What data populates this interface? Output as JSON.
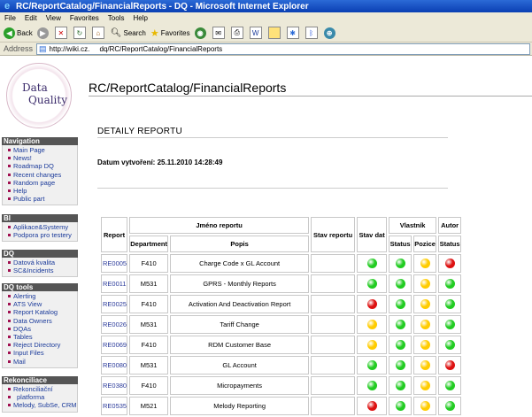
{
  "window": {
    "title": "RC/ReportCatalog/FinancialReports - DQ - Microsoft Internet Explorer"
  },
  "menu": [
    "File",
    "Edit",
    "View",
    "Favorites",
    "Tools",
    "Help"
  ],
  "toolbar": {
    "back": "Back",
    "search": "Search",
    "favorites": "Favorites"
  },
  "address": {
    "label": "Address",
    "url": "http://wiki.cz.     dq/RC/ReportCatalog/FinancialReports"
  },
  "logo": {
    "line1": "Data",
    "line2": "Quality"
  },
  "sidebar": [
    {
      "title": "Navigation",
      "items": [
        "Main Page",
        "News!",
        "Roadmap DQ",
        "Recent changes",
        "Random page",
        "Help",
        "Public part"
      ]
    },
    {
      "title": "BI",
      "items": [
        "Aplikace&Systemy",
        "Podpora pro testery"
      ]
    },
    {
      "title": "DQ",
      "items": [
        "Datová kvalita",
        "SC&Incidents"
      ]
    },
    {
      "title": "DQ tools",
      "items": [
        "Alerting",
        "ATS View",
        "Report Katalog",
        "Data Owners",
        "DQAs",
        "Tables",
        "Reject Directory",
        "Input Files",
        "Mail"
      ]
    },
    {
      "title": "Rekonciliace",
      "items": [
        "Rekonciliační",
        "platforma",
        "Melody, SubSe, CRM"
      ]
    }
  ],
  "page": {
    "title": "RC/ReportCatalog/FinancialReports",
    "section": "DETAILY REPORTU",
    "date_label": "Datum vytvoření: 25.11.2010 14:28:49"
  },
  "table": {
    "headers": {
      "report": "Report",
      "jmeno": "Jméno reportu",
      "department": "Department",
      "popis": "Popis",
      "stav_reportu": "Stav reportu",
      "stav_dat": "Stav dat",
      "vlastnik": "Vlastník",
      "status": "Status",
      "pozice": "Pozice",
      "autor": "Autor",
      "autor_status": "Status"
    },
    "colors": {
      "green": "#22cc22",
      "yellow": "#ffcc00",
      "red": "#dd1111"
    },
    "rows": [
      {
        "report": "RE0005",
        "department": "F410",
        "popis": "Charge Code x GL Account",
        "stav_dat": "green",
        "vl_status": "green",
        "pozice": "yellow",
        "autor_status": "red"
      },
      {
        "report": "RE0011",
        "department": "M531",
        "popis": "GPRS - Monthly Reports",
        "stav_dat": "green",
        "vl_status": "green",
        "pozice": "yellow",
        "autor_status": "green"
      },
      {
        "report": "RE0025",
        "department": "F410",
        "popis": "Activation And Deactivation Report",
        "stav_dat": "red",
        "vl_status": "green",
        "pozice": "yellow",
        "autor_status": "green"
      },
      {
        "report": "RE0026",
        "department": "M531",
        "popis": "Tariff Change",
        "stav_dat": "yellow",
        "vl_status": "green",
        "pozice": "yellow",
        "autor_status": "green"
      },
      {
        "report": "RE0069",
        "department": "F410",
        "popis": "RDM Customer Base",
        "stav_dat": "yellow",
        "vl_status": "green",
        "pozice": "yellow",
        "autor_status": "green"
      },
      {
        "report": "RE0080",
        "department": "M531",
        "popis": "GL Account",
        "stav_dat": "green",
        "vl_status": "green",
        "pozice": "yellow",
        "autor_status": "red"
      },
      {
        "report": "RE0380",
        "department": "F410",
        "popis": "Micropayments",
        "stav_dat": "green",
        "vl_status": "green",
        "pozice": "yellow",
        "autor_status": "green"
      },
      {
        "report": "RE0535",
        "department": "M521",
        "popis": "Melody Reporting",
        "stav_dat": "red",
        "vl_status": "green",
        "pozice": "yellow",
        "autor_status": "green"
      }
    ]
  }
}
